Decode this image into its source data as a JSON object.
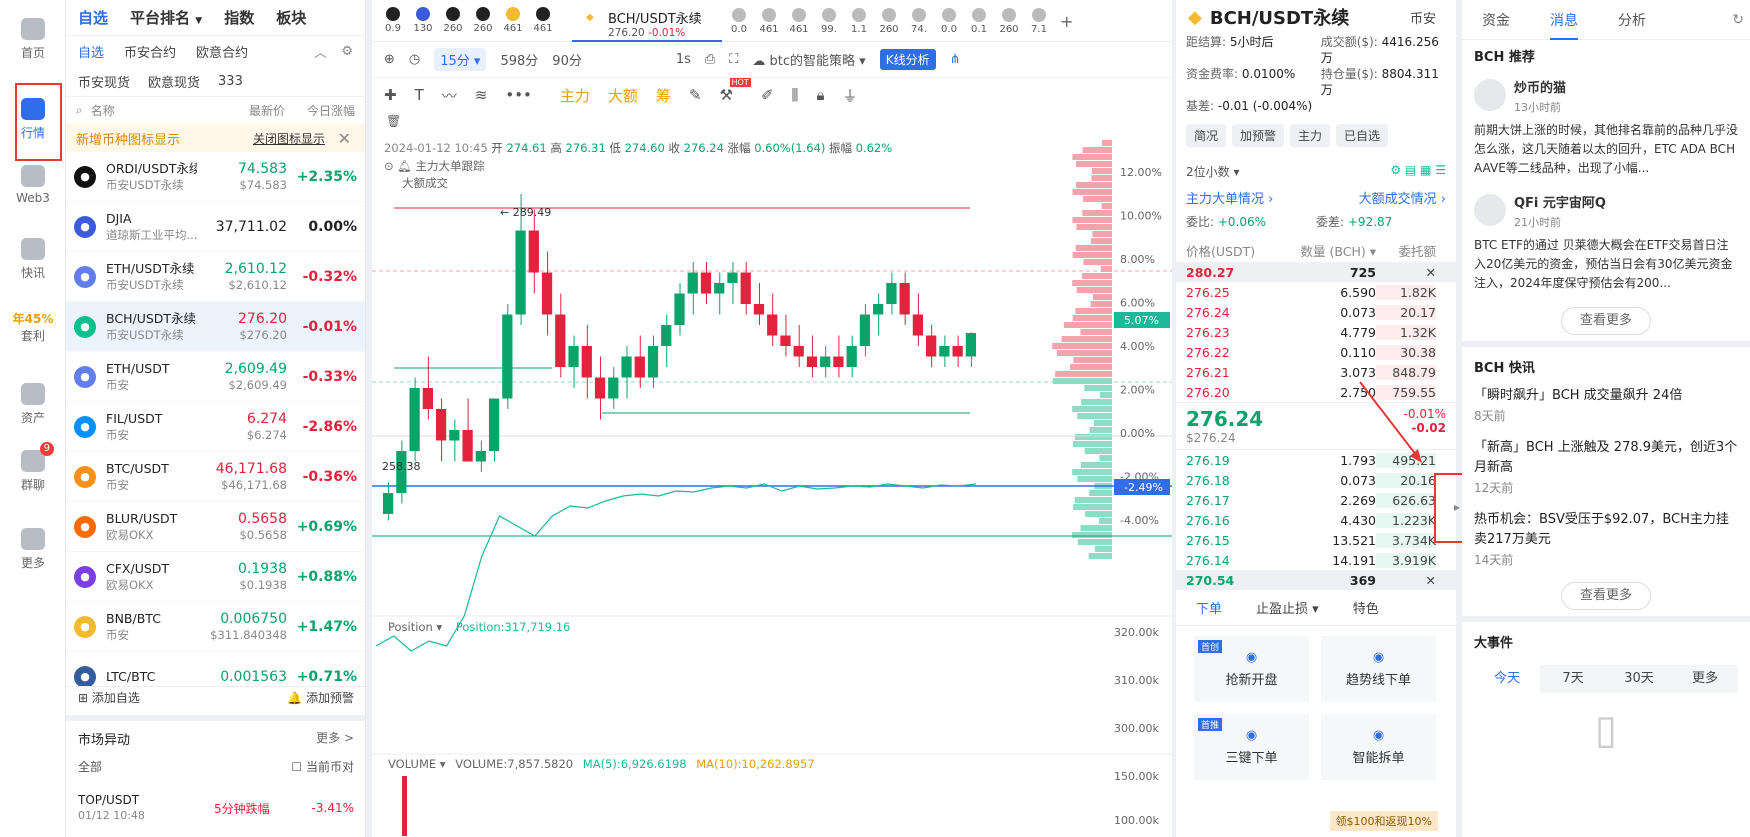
{
  "nav": [
    {
      "label": "首页",
      "icon": "home-icon"
    },
    {
      "label": "行情",
      "icon": "market-chart-icon",
      "active": true
    },
    {
      "label": "Web3",
      "icon": "web3-icon"
    },
    {
      "label": "快讯",
      "icon": "news-flash-icon"
    },
    {
      "label": "年45%",
      "sub": "套利",
      "icon": "arbitrage-icon"
    },
    {
      "label": "资产",
      "icon": "wallet-icon"
    },
    {
      "label": "群聊",
      "icon": "chat-icon",
      "badge": "9"
    },
    {
      "label": "更多",
      "icon": "more-apps-icon"
    }
  ],
  "watchlist": {
    "tabs1": [
      "自选",
      "平台排名",
      "指数",
      "板块"
    ],
    "tabs2": [
      "自选",
      "币安合约",
      "欧意合约"
    ],
    "tabs3": [
      "币安现货",
      "欧意现货",
      "333"
    ],
    "headers": {
      "name": "名称",
      "price": "最新价",
      "change": "今日涨幅"
    },
    "notice": "新增币种图标显示",
    "notice_link": "关闭图标显示",
    "rows": [
      {
        "name": "ORDI/USDT永续",
        "sub": "币安USDT永续",
        "price": "74.583",
        "usd": "$74.583",
        "change": "+2.35%",
        "dir": "up",
        "color": "#111"
      },
      {
        "name": "DJIA",
        "sub": "道琼斯工业平均...",
        "price": "37,711.02",
        "usd": "",
        "change": "0.00%",
        "dir": "flat",
        "color": "#3b5bdb"
      },
      {
        "name": "ETH/USDT永续",
        "sub": "币安USDT永续",
        "price": "2,610.12",
        "usd": "$2,610.12",
        "change": "-0.32%",
        "dir": "up",
        "chdir": "dn",
        "color": "#627eea"
      },
      {
        "name": "BCH/USDT永续",
        "sub": "币安USDT永续",
        "price": "276.20",
        "usd": "$276.20",
        "change": "-0.01%",
        "dir": "dn",
        "color": "#0ac18e",
        "selected": true
      },
      {
        "name": "ETH/USDT",
        "sub": "币安",
        "price": "2,609.49",
        "usd": "$2,609.49",
        "change": "-0.33%",
        "dir": "up",
        "chdir": "dn",
        "color": "#627eea"
      },
      {
        "name": "FIL/USDT",
        "sub": "币安",
        "price": "6.274",
        "usd": "$6.274",
        "change": "-2.86%",
        "dir": "dn",
        "color": "#0090ff"
      },
      {
        "name": "BTC/USDT",
        "sub": "币安",
        "price": "46,171.68",
        "usd": "$46,171.68",
        "change": "-0.36%",
        "dir": "dn",
        "color": "#f7931a"
      },
      {
        "name": "BLUR/USDT",
        "sub": "欧易OKX",
        "price": "0.5658",
        "usd": "$0.5658",
        "change": "+0.69%",
        "dir": "dn",
        "chdir": "up",
        "color": "#ff6b00"
      },
      {
        "name": "CFX/USDT",
        "sub": "欧易OKX",
        "price": "0.1938",
        "usd": "$0.1938",
        "change": "+0.88%",
        "dir": "up",
        "color": "#7b3fe4"
      },
      {
        "name": "BNB/BTC",
        "sub": "币安",
        "price": "0.006750",
        "usd": "$311.840348",
        "change": "+1.47%",
        "dir": "up",
        "color": "#f3ba2f"
      },
      {
        "name": "LTC/BTC",
        "sub": "",
        "price": "0.001563",
        "usd": "",
        "change": "+0.71%",
        "dir": "up",
        "color": "#345d9d"
      }
    ],
    "footer_left": "添加自选",
    "footer_right": "添加预警",
    "market_title": "市场异动",
    "market_more": "更多 >",
    "market_filter": "全部",
    "market_current": "当前币对",
    "market_item": {
      "name": "TOP/USDT",
      "time": "01/12 10:48",
      "event": "5分钟跌幅",
      "change": "-3.41%"
    }
  },
  "symtabs": [
    "0.9",
    "130",
    "260",
    "260",
    "461",
    "461"
  ],
  "symtabs_right": [
    "0.0",
    "461",
    "461",
    "99.",
    "1.1",
    "260",
    "74.",
    "0.0",
    "0.1",
    "260",
    "7.1"
  ],
  "active_tab": {
    "name": "BCH/USDT永续",
    "price": "276.20",
    "change": "-0.01%"
  },
  "toolbar1": {
    "interval": "15分",
    "i2": "598分",
    "i3": "90分",
    "s1": "1s",
    "strategy": "btc的智能策略",
    "kline": "K线分析"
  },
  "toolbar2": {
    "main": "主力",
    "large": "大额",
    "chip": "筹",
    "hot": "HOT"
  },
  "ohlc": {
    "date": "2024-01-12 10:45",
    "open_l": "开",
    "open": "274.61",
    "high_l": "高",
    "high": "276.31",
    "low_l": "低",
    "low": "274.60",
    "close_l": "收",
    "close": "276.24",
    "chg_l": "涨幅",
    "chg": "0.60%(1.64)",
    "amp_l": "振幅",
    "amp": "0.62%"
  },
  "chart_labels": {
    "main_track": "主力大单跟踪",
    "large_deal": "大额成交",
    "hi_mark": "289.49",
    "lo_mark": "258.38",
    "tag_up": "5.07%",
    "tag_dn": "-2.49%"
  },
  "pct_axis": [
    "12.00%",
    "10.00%",
    "8.00%",
    "6.00%",
    "4.00%",
    "2.00%",
    "0.00%",
    "-2.00%",
    "-4.00%"
  ],
  "position": {
    "label": "Position",
    "value": "Position:317,719.16",
    "axis": [
      "320.00k",
      "310.00k",
      "300.00k"
    ]
  },
  "volume": {
    "label": "VOLUME",
    "v": "VOLUME:7,857.5820",
    "ma5": "MA(5):6,926.6198",
    "ma10": "MA(10):10,262.8957",
    "axis": [
      "150.00k",
      "100.00k"
    ]
  },
  "chart_data": {
    "type": "candlestick",
    "title": "BCH/USDT永续",
    "interval": "15分",
    "y_range": [
      258.38,
      289.49
    ],
    "candles": [
      [
        259,
        262,
        258.38,
        261
      ],
      [
        261,
        266,
        260,
        265
      ],
      [
        265,
        272,
        264,
        271
      ],
      [
        271,
        274,
        268,
        269
      ],
      [
        269,
        270,
        264,
        266
      ],
      [
        266,
        268,
        264,
        267
      ],
      [
        267,
        270,
        265,
        264
      ],
      [
        264,
        266,
        263,
        265
      ],
      [
        265,
        270,
        264,
        270
      ],
      [
        270,
        279,
        269,
        278
      ],
      [
        278,
        289.49,
        277,
        286
      ],
      [
        286,
        288,
        280,
        282
      ],
      [
        282,
        284,
        276,
        278
      ],
      [
        278,
        280,
        272,
        273
      ],
      [
        273,
        276,
        271,
        275
      ],
      [
        275,
        277,
        270,
        272
      ],
      [
        272,
        274,
        268,
        270
      ],
      [
        270,
        273,
        269,
        272
      ],
      [
        272,
        275,
        270,
        274
      ],
      [
        274,
        276,
        271,
        272
      ],
      [
        272,
        276,
        271,
        275
      ],
      [
        275,
        278,
        273,
        277
      ],
      [
        277,
        281,
        276,
        280
      ],
      [
        280,
        283,
        278,
        282
      ],
      [
        282,
        283,
        279,
        280
      ],
      [
        280,
        282,
        278,
        281
      ],
      [
        281,
        283,
        279,
        282
      ],
      [
        282,
        283,
        278,
        279
      ],
      [
        279,
        281,
        277,
        278
      ],
      [
        278,
        280,
        275,
        276
      ],
      [
        276,
        278,
        274,
        275
      ],
      [
        275,
        277,
        273,
        274
      ],
      [
        274,
        276,
        272,
        273
      ],
      [
        273,
        275,
        272,
        274
      ],
      [
        274,
        276,
        272,
        273
      ],
      [
        273,
        276,
        272,
        275
      ],
      [
        275,
        279,
        274,
        278
      ],
      [
        278,
        280,
        276,
        279
      ],
      [
        279,
        282,
        278,
        281
      ],
      [
        281,
        282,
        277,
        278
      ],
      [
        278,
        280,
        275,
        276
      ],
      [
        276,
        277,
        273,
        274
      ],
      [
        274,
        276,
        273,
        275
      ],
      [
        275,
        276,
        273,
        274
      ],
      [
        274,
        276.31,
        273,
        276.24
      ]
    ]
  },
  "orderbook": {
    "title": "BCH/USDT永续",
    "exchange": "币安",
    "settle_l": "距结算",
    "settle": "5小时后",
    "turnover_l": "成交额($)",
    "turnover": "4416.256万",
    "fund_l": "资金费率",
    "fund": "0.0100%",
    "oi_l": "持仓量($)",
    "oi": "8804.311万",
    "basis_l": "基差",
    "basis": "-0.01 (-0.004%)",
    "btns": [
      "简况",
      "加预警",
      "主力",
      "已自选"
    ],
    "decimals": "2位小数",
    "main_order": "主力大单情况",
    "large_deal": "大额成交情况",
    "wb_l": "委比",
    "wb": "+0.06%",
    "wc_l": "委差",
    "wc": "+92.87",
    "cols": [
      "价格(USDT)",
      "数量 (BCH)",
      "委托额"
    ],
    "ask_top": {
      "price": "280.27",
      "qty": "725"
    },
    "asks": [
      {
        "price": "276.25",
        "qty": "6.590",
        "amt": "1.82K"
      },
      {
        "price": "276.24",
        "qty": "0.073",
        "amt": "20.17"
      },
      {
        "price": "276.23",
        "qty": "4.779",
        "amt": "1.32K"
      },
      {
        "price": "276.22",
        "qty": "0.110",
        "amt": "30.38"
      },
      {
        "price": "276.21",
        "qty": "3.073",
        "amt": "848.79"
      },
      {
        "price": "276.20",
        "qty": "2.750",
        "amt": "759.55"
      }
    ],
    "last": "276.24",
    "last_usd": "$276.24",
    "last_pct": "-0.01%",
    "last_chg": "-0.02",
    "bids": [
      {
        "price": "276.19",
        "qty": "1.793",
        "amt": "495.21"
      },
      {
        "price": "276.18",
        "qty": "0.073",
        "amt": "20.16"
      },
      {
        "price": "276.17",
        "qty": "2.269",
        "amt": "626.63"
      },
      {
        "price": "276.16",
        "qty": "4.430",
        "amt": "1.223K"
      },
      {
        "price": "276.15",
        "qty": "13.521",
        "amt": "3.734K"
      },
      {
        "price": "276.14",
        "qty": "14.191",
        "amt": "3.919K"
      }
    ],
    "bid_bottom": {
      "price": "270.54",
      "qty": "369"
    },
    "order_tabs": [
      "下单",
      "止盈止损",
      "特色"
    ],
    "cards": [
      {
        "tag": "首创",
        "label": "抢新开盘"
      },
      {
        "tag": "",
        "label": "趋势线下单"
      },
      {
        "tag": "首推",
        "label": "三键下单"
      },
      {
        "tag": "",
        "label": "智能拆单"
      }
    ],
    "promo": "领$100和返现10%"
  },
  "sidebar": {
    "tabs": [
      "资金",
      "消息",
      "分析"
    ],
    "rec_title": "BCH 推荐",
    "posts": [
      {
        "user": "炒币的猫",
        "time": "13小时前",
        "text": "前期大饼上涨的时候，其他排名靠前的品种几乎没怎么涨，这几天随着以太的回升，ETC ADA BCH AAVE等二线品种，出现了小幅..."
      },
      {
        "user": "QFi 元宇宙阿Q",
        "time": "21小时前",
        "text": "BTC ETF的通过 贝莱德大概会在ETF交易首日注入20亿美元的资金，预估当日会有30亿美元资金注入，2024年度保守预估会有200..."
      }
    ],
    "more1": "查看更多",
    "flash_title": "BCH 快讯",
    "news": [
      {
        "text": "「瞬时飙升」BCH 成交量飙升 24倍",
        "time": "8天前"
      },
      {
        "text": "「新高」BCH 上涨触及 278.9美元，创近3个月新高",
        "time": "12天前"
      },
      {
        "text": "热币机会：BSV受压于$92.07，BCH主力挂卖217万美元",
        "time": "14天前"
      }
    ],
    "more2": "查看更多",
    "events_title": "大事件",
    "event_tabs": [
      "今天",
      "7天",
      "30天",
      "更多"
    ]
  }
}
